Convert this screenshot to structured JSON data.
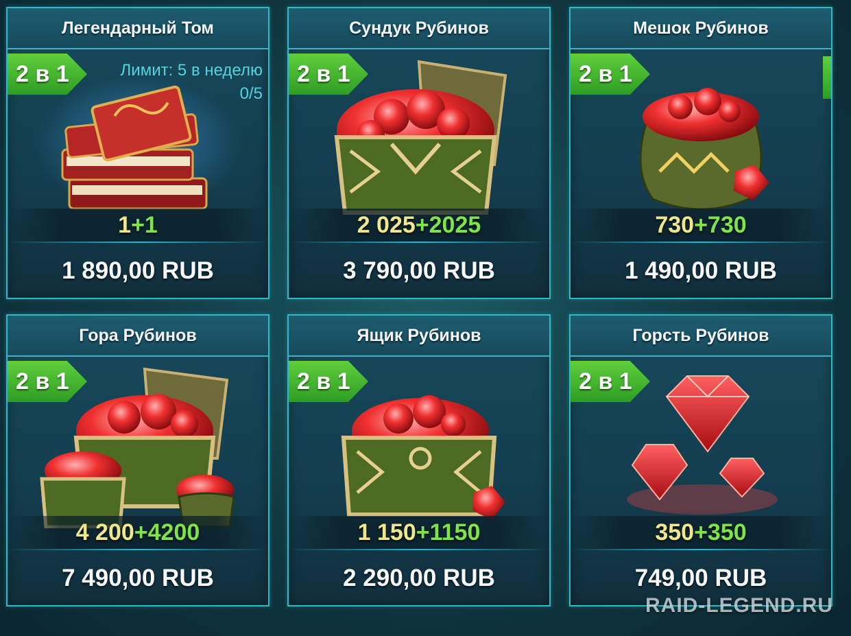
{
  "cards": [
    {
      "title": "Легендарный Том",
      "badge": "2 в 1",
      "limit_label": "Лимит: 5 в неделю",
      "limit_progress": "0/5",
      "amount_base": "1",
      "amount_bonus": "+1",
      "price": "1 890,00 RUB",
      "icon": "legendary-tome-icon"
    },
    {
      "title": "Сундук Рубинов",
      "badge": "2 в 1",
      "amount_base": "2 025",
      "amount_bonus": "+2025",
      "price": "3 790,00 RUB",
      "icon": "ruby-chest-icon"
    },
    {
      "title": "Мешок Рубинов",
      "badge": "2 в 1",
      "amount_base": "730",
      "amount_bonus": "+730",
      "price": "1 490,00 RUB",
      "icon": "ruby-sack-icon"
    },
    {
      "title": "Гора Рубинов",
      "badge": "2 в 1",
      "amount_base": "4 200",
      "amount_bonus": "+4200",
      "price": "7 490,00 RUB",
      "icon": "ruby-mountain-icon"
    },
    {
      "title": "Ящик Рубинов",
      "badge": "2 в 1",
      "amount_base": "1 150",
      "amount_bonus": "+1150",
      "price": "2 290,00 RUB",
      "icon": "ruby-box-icon"
    },
    {
      "title": "Горсть Рубинов",
      "badge": "2 в 1",
      "amount_base": "350",
      "amount_bonus": "+350",
      "price": "749,00 RUB",
      "icon": "ruby-handful-icon"
    }
  ],
  "watermark": "RAID-LEGEND.RU",
  "colors": {
    "frame": "#2fb8c8",
    "badge": "#3fae2c",
    "amount_base": "#f0e68c",
    "amount_bonus": "#7fe34a",
    "ruby": "#e0202a"
  }
}
